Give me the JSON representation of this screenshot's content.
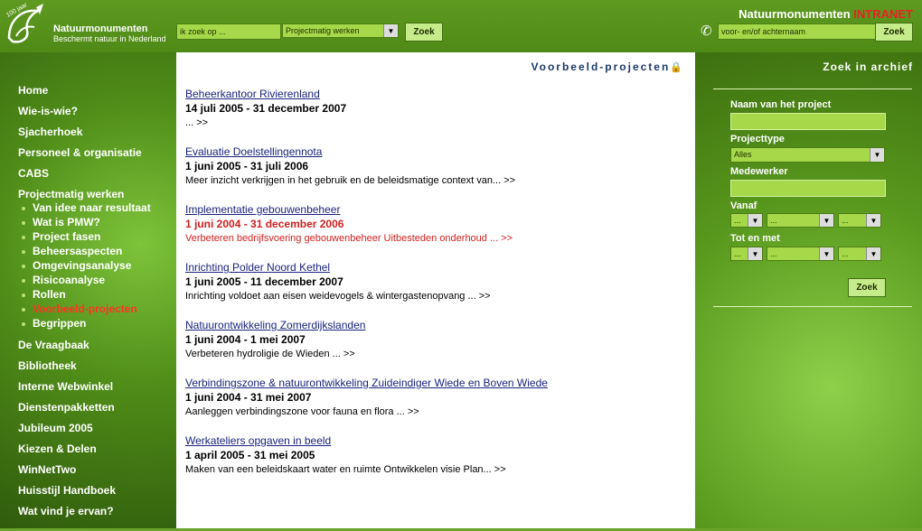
{
  "header": {
    "logo": {
      "name": "Natuurmonumenten",
      "tagline": "Beschermt natuur in Nederland",
      "badge": "100 jaar"
    },
    "search_placeholder": "ik zoek op ...",
    "search_scope": "Projectmatig werken",
    "search_button": "Zoek",
    "brand": "Natuurmonumenten",
    "brand_suffix": "INTRANET",
    "person_placeholder": "voor- en/of achternaam",
    "person_button": "Zoek"
  },
  "nav": {
    "items_top": [
      "Home",
      "Wie-is-wie?",
      "Sjacherhoek",
      "Personeel & organisatie",
      "CABS",
      "Projectmatig werken"
    ],
    "sub_items": [
      "Van idee naar resultaat",
      "Wat is PMW?",
      "Project fasen",
      "Beheersaspecten",
      "Omgevingsanalyse",
      "Risicoanalyse",
      "Rollen",
      "Voorbeeld-projecten",
      "Begrippen"
    ],
    "active_sub": "Voorbeeld-projecten",
    "items_bottom": [
      "De Vraagbaak",
      "Bibliotheek",
      "Interne Webwinkel",
      "Dienstenpakketten",
      "Jubileum 2005",
      "Kiezen & Delen",
      "WinNetTwo",
      "Huisstijl Handboek",
      "Wat vind je ervan?"
    ]
  },
  "content": {
    "title": "Voorbeeld-projecten",
    "projects": [
      {
        "title": "Beheerkantoor Rivierenland",
        "dates": "14 juli 2005 - 31 december 2007",
        "desc": "... >>"
      },
      {
        "title": "Evaluatie Doelstellingennota",
        "dates": "1 juni 2005 - 31 juli 2006",
        "desc": "Meer inzicht verkrijgen in het gebruik en de beleidsmatige context van... >>"
      },
      {
        "title": "Implementatie gebouwenbeheer",
        "dates": "1 juni 2004 - 31 december 2006",
        "desc": "Verbeteren bedrijfsvoering gebouwenbeheer Uitbesteden onderhoud ... >>"
      },
      {
        "title": "Inrichting Polder Noord Kethel",
        "dates": "1 juni 2005 - 11 december 2007",
        "desc": "Inrichting voldoet aan eisen weidevogels & wintergastenopvang ... >>"
      },
      {
        "title": "Natuurontwikkeling Zomerdijkslanden",
        "dates": "1 juni 2004 - 1 mei 2007",
        "desc": "Verbeteren hydroligie de Wieden ... >>"
      },
      {
        "title": "Verbindingszone & natuurontwikkeling Zuideindiger Wiede en Boven Wiede",
        "dates": "1 juni 2004 - 31 mei 2007",
        "desc": "Aanleggen verbindingszone voor fauna en flora ... >>"
      },
      {
        "title": "Werkateliers opgaven in beeld",
        "dates": "1 april 2005 - 31 mei 2005",
        "desc": "Maken van een beleidskaart water en ruimte Ontwikkelen visie Plan... >>"
      }
    ]
  },
  "archive": {
    "title": "Zoek in archief",
    "project_name_label": "Naam van het project",
    "type_label": "Projecttype",
    "type_value": "Alles",
    "employee_label": "Medewerker",
    "from_label": "Vanaf",
    "to_label": "Tot en met",
    "date_placeholder": "...",
    "search_button": "Zoek"
  }
}
